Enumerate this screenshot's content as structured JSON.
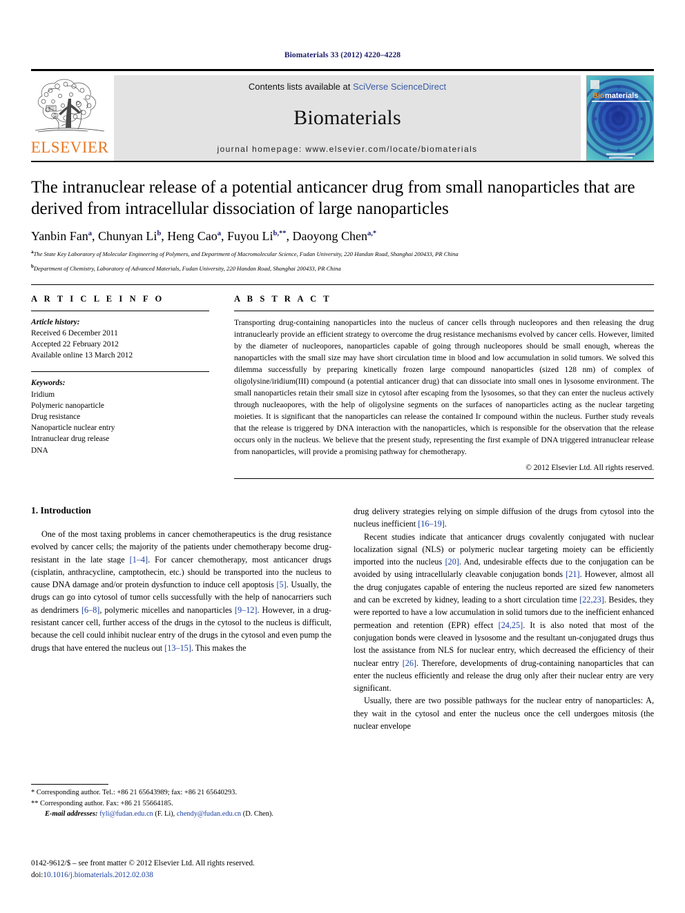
{
  "running_head": "Biomaterials 33 (2012) 4220–4228",
  "masthead": {
    "publisher_name": "ELSEVIER",
    "contents_prefix": "Contents lists available at ",
    "sciencedirect_link": "SciVerse ScienceDirect",
    "journal_title": "Biomaterials",
    "homepage_line": "journal homepage: www.elsevier.com/locate/biomaterials",
    "cover_brand_prefix": "Bio",
    "cover_brand_suffix": "materials",
    "link_color": "#3b5ba5",
    "elsevier_orange": "#E87722"
  },
  "article": {
    "title": "The intranuclear release of a potential anticancer drug from small nanoparticles that are derived from intracellular dissociation of large nanoparticles",
    "authors_html": "Yanbin Fan a, Chunyan Li b, Heng Cao a, Fuyou Li b,**, Daoyong Chen a,*",
    "authors": [
      {
        "name": "Yanbin Fan",
        "sup": "a"
      },
      {
        "name": "Chunyan Li",
        "sup": "b"
      },
      {
        "name": "Heng Cao",
        "sup": "a"
      },
      {
        "name": "Fuyou Li",
        "sup": "b,**"
      },
      {
        "name": "Daoyong Chen",
        "sup": "a,*"
      }
    ],
    "affiliations": [
      {
        "marker": "a",
        "text": "The State Key Laboratory of Molecular Engineering of Polymers, and Department of Macromolecular Science, Fudan University, 220 Handan Road, Shanghai 200433, PR China"
      },
      {
        "marker": "b",
        "text": "Department of Chemistry, Laboratory of Advanced Materials, Fudan University, 220 Handan Road, Shanghai 200433, PR China"
      }
    ]
  },
  "article_info": {
    "heading": "A R T I C L E   I N F O",
    "history_label": "Article history:",
    "history": [
      "Received 6 December 2011",
      "Accepted 22 February 2012",
      "Available online 13 March 2012"
    ],
    "keywords_label": "Keywords:",
    "keywords": [
      "Iridium",
      "Polymeric nanoparticle",
      "Drug resistance",
      "Nanoparticle nuclear entry",
      "Intranuclear drug release",
      "DNA"
    ]
  },
  "abstract": {
    "heading": "A B S T R A C T",
    "text": "Transporting drug-containing nanoparticles into the nucleus of cancer cells through nucleopores and then releasing the drug intranuclearly provide an efficient strategy to overcome the drug resistance mechanisms evolved by cancer cells. However, limited by the diameter of nucleopores, nanoparticles capable of going through nucleopores should be small enough, whereas the nanoparticles with the small size may have short circulation time in blood and low accumulation in solid tumors. We solved this dilemma successfully by preparing kinetically frozen large compound nanoparticles (sized 128 nm) of complex of oligolysine/iridium(III) compound (a potential anticancer drug) that can dissociate into small ones in lysosome environment. The small nanoparticles retain their small size in cytosol after escaping from the lysosomes, so that they can enter the nucleus actively through nucleaopores, with the help of oligolysine segments on the surfaces of nanoparticles acting as the nuclear targeting moieties. It is significant that the nanoparticles can release the contained Ir compound within the nucleus. Further study reveals that the release is triggered by DNA interaction with the nanoparticles, which is responsible for the observation that the release occurs only in the nucleus. We believe that the present study, representing the first example of DNA triggered intranuclear release from nanoparticles, will provide a promising pathway for chemotherapy.",
    "copyright": "© 2012 Elsevier Ltd. All rights reserved."
  },
  "introduction": {
    "heading": "1. Introduction",
    "left_paragraph_1": "One of the most taxing problems in cancer chemotherapeutics is the drug resistance evolved by cancer cells; the majority of the patients under chemotherapy become drug-resistant in the late stage [1–4]. For cancer chemotherapy, most anticancer drugs (cisplatin, anthracycline, camptothecin, etc.) should be transported into the nucleus to cause DNA damage and/or protein dysfunction to induce cell apoptosis [5]. Usually, the drugs can go into cytosol of tumor cells successfully with the help of nanocarriers such as dendrimers [6–8], polymeric micelles and nanoparticles [9–12]. However, in a drug-resistant cancer cell, further access of the drugs in the cytosol to the nucleus is difficult, because the cell could inhibit nuclear entry of the drugs in the cytosol and even pump the drugs that have entered the nucleus out [13–15]. This makes the",
    "right_paragraph_1_cont": "drug delivery strategies relying on simple diffusion of the drugs from cytosol into the nucleus inefficient [16–19].",
    "right_paragraph_2": "Recent studies indicate that anticancer drugs covalently conjugated with nuclear localization signal (NLS) or polymeric nuclear targeting moiety can be efficiently imported into the nucleus [20]. And, undesirable effects due to the conjugation can be avoided by using intracellularly cleavable conjugation bonds [21]. However, almost all the drug conjugates capable of entering the nucleus reported are sized few nanometers and can be excreted by kidney, leading to a short circulation time [22,23]. Besides, they were reported to have a low accumulation in solid tumors due to the inefficient enhanced permeation and retention (EPR) effect [24,25]. It is also noted that most of the conjugation bonds were cleaved in lysosome and the resultant un-conjugated drugs thus lost the assistance from NLS for nuclear entry, which decreased the efficiency of their nuclear entry [26]. Therefore, developments of drug-containing nanoparticles that can enter the nucleus efficiently and release the drug only after their nuclear entry are very significant.",
    "right_paragraph_3": "Usually, there are two possible pathways for the nuclear entry of nanoparticles: A, they wait in the cytosol and enter the nucleus once the cell undergoes mitosis (the nuclear envelope"
  },
  "footnotes": {
    "corresponding_1": "* Corresponding author. Tel.: +86 21 65643989; fax: +86 21 65640293.",
    "corresponding_2": "** Corresponding author. Fax: +86 21 55664185.",
    "email_label": "E-mail addresses:",
    "email_1": "fyli@fudan.edu.cn",
    "email_1_owner": "(F. Li),",
    "email_2": "chendy@fudan.edu.cn",
    "email_2_owner": "(D. Chen)."
  },
  "footer": {
    "issn_line": "0142-9612/$ – see front matter © 2012 Elsevier Ltd. All rights reserved.",
    "doi_prefix": "doi:",
    "doi": "10.1016/j.biomaterials.2012.02.038"
  }
}
